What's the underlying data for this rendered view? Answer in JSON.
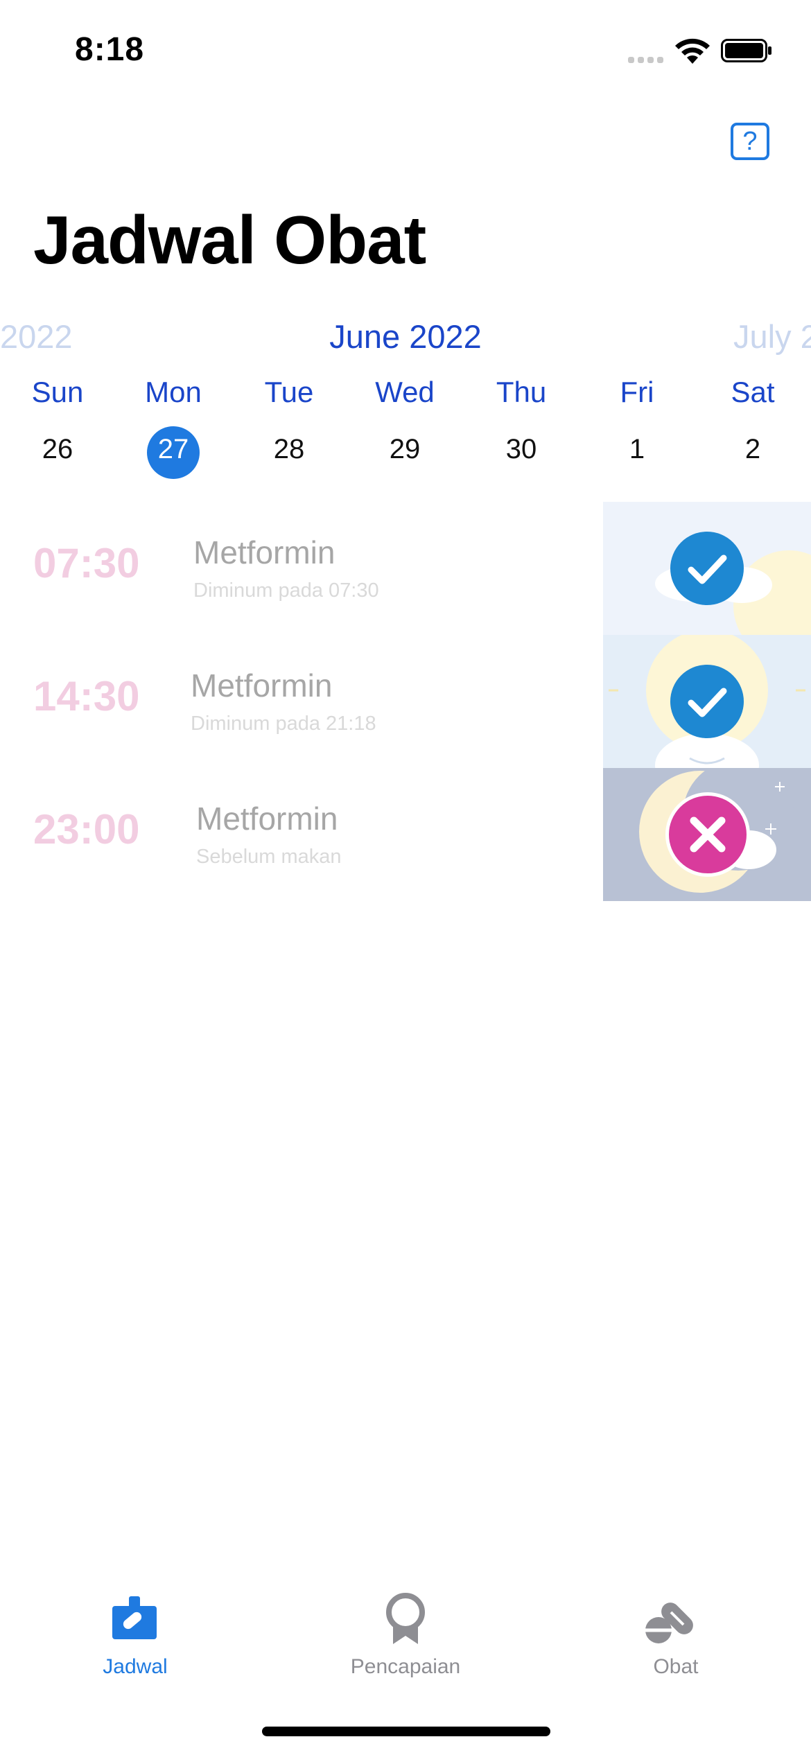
{
  "status_bar": {
    "time": "8:18"
  },
  "header": {
    "help_label": "?",
    "title": "Jadwal Obat"
  },
  "calendar": {
    "prev_month": "2022",
    "current_month": "June 2022",
    "next_month": "July 2",
    "weekdays": [
      "Sun",
      "Mon",
      "Tue",
      "Wed",
      "Thu",
      "Fri",
      "Sat"
    ],
    "days": [
      "26",
      "27",
      "28",
      "29",
      "30",
      "1",
      "2"
    ],
    "selected_day": "27"
  },
  "schedule": [
    {
      "time": "07:30",
      "medicine": "Metformin",
      "note": "Diminum pada 07:30",
      "status": "taken",
      "period": "morning",
      "status_icon": "check-icon"
    },
    {
      "time": "14:30",
      "medicine": "Metformin",
      "note": "Diminum pada 21:18",
      "status": "taken",
      "period": "afternoon",
      "status_icon": "check-icon"
    },
    {
      "time": "23:00",
      "medicine": "Metformin",
      "note": "Sebelum makan",
      "status": "missed",
      "period": "night",
      "status_icon": "x-icon"
    }
  ],
  "tab_bar": {
    "tabs": [
      {
        "label": "Jadwal",
        "icon": "schedule-icon",
        "active": true
      },
      {
        "label": "Pencapaian",
        "icon": "award-icon",
        "active": false
      },
      {
        "label": "Obat",
        "icon": "pills-icon",
        "active": false
      }
    ]
  },
  "colors": {
    "accent": "#1f7ae0",
    "month_text": "#1a45c9",
    "time_text": "#f2cde1",
    "taken": "#1e88d2",
    "missed": "#d93b9c"
  }
}
